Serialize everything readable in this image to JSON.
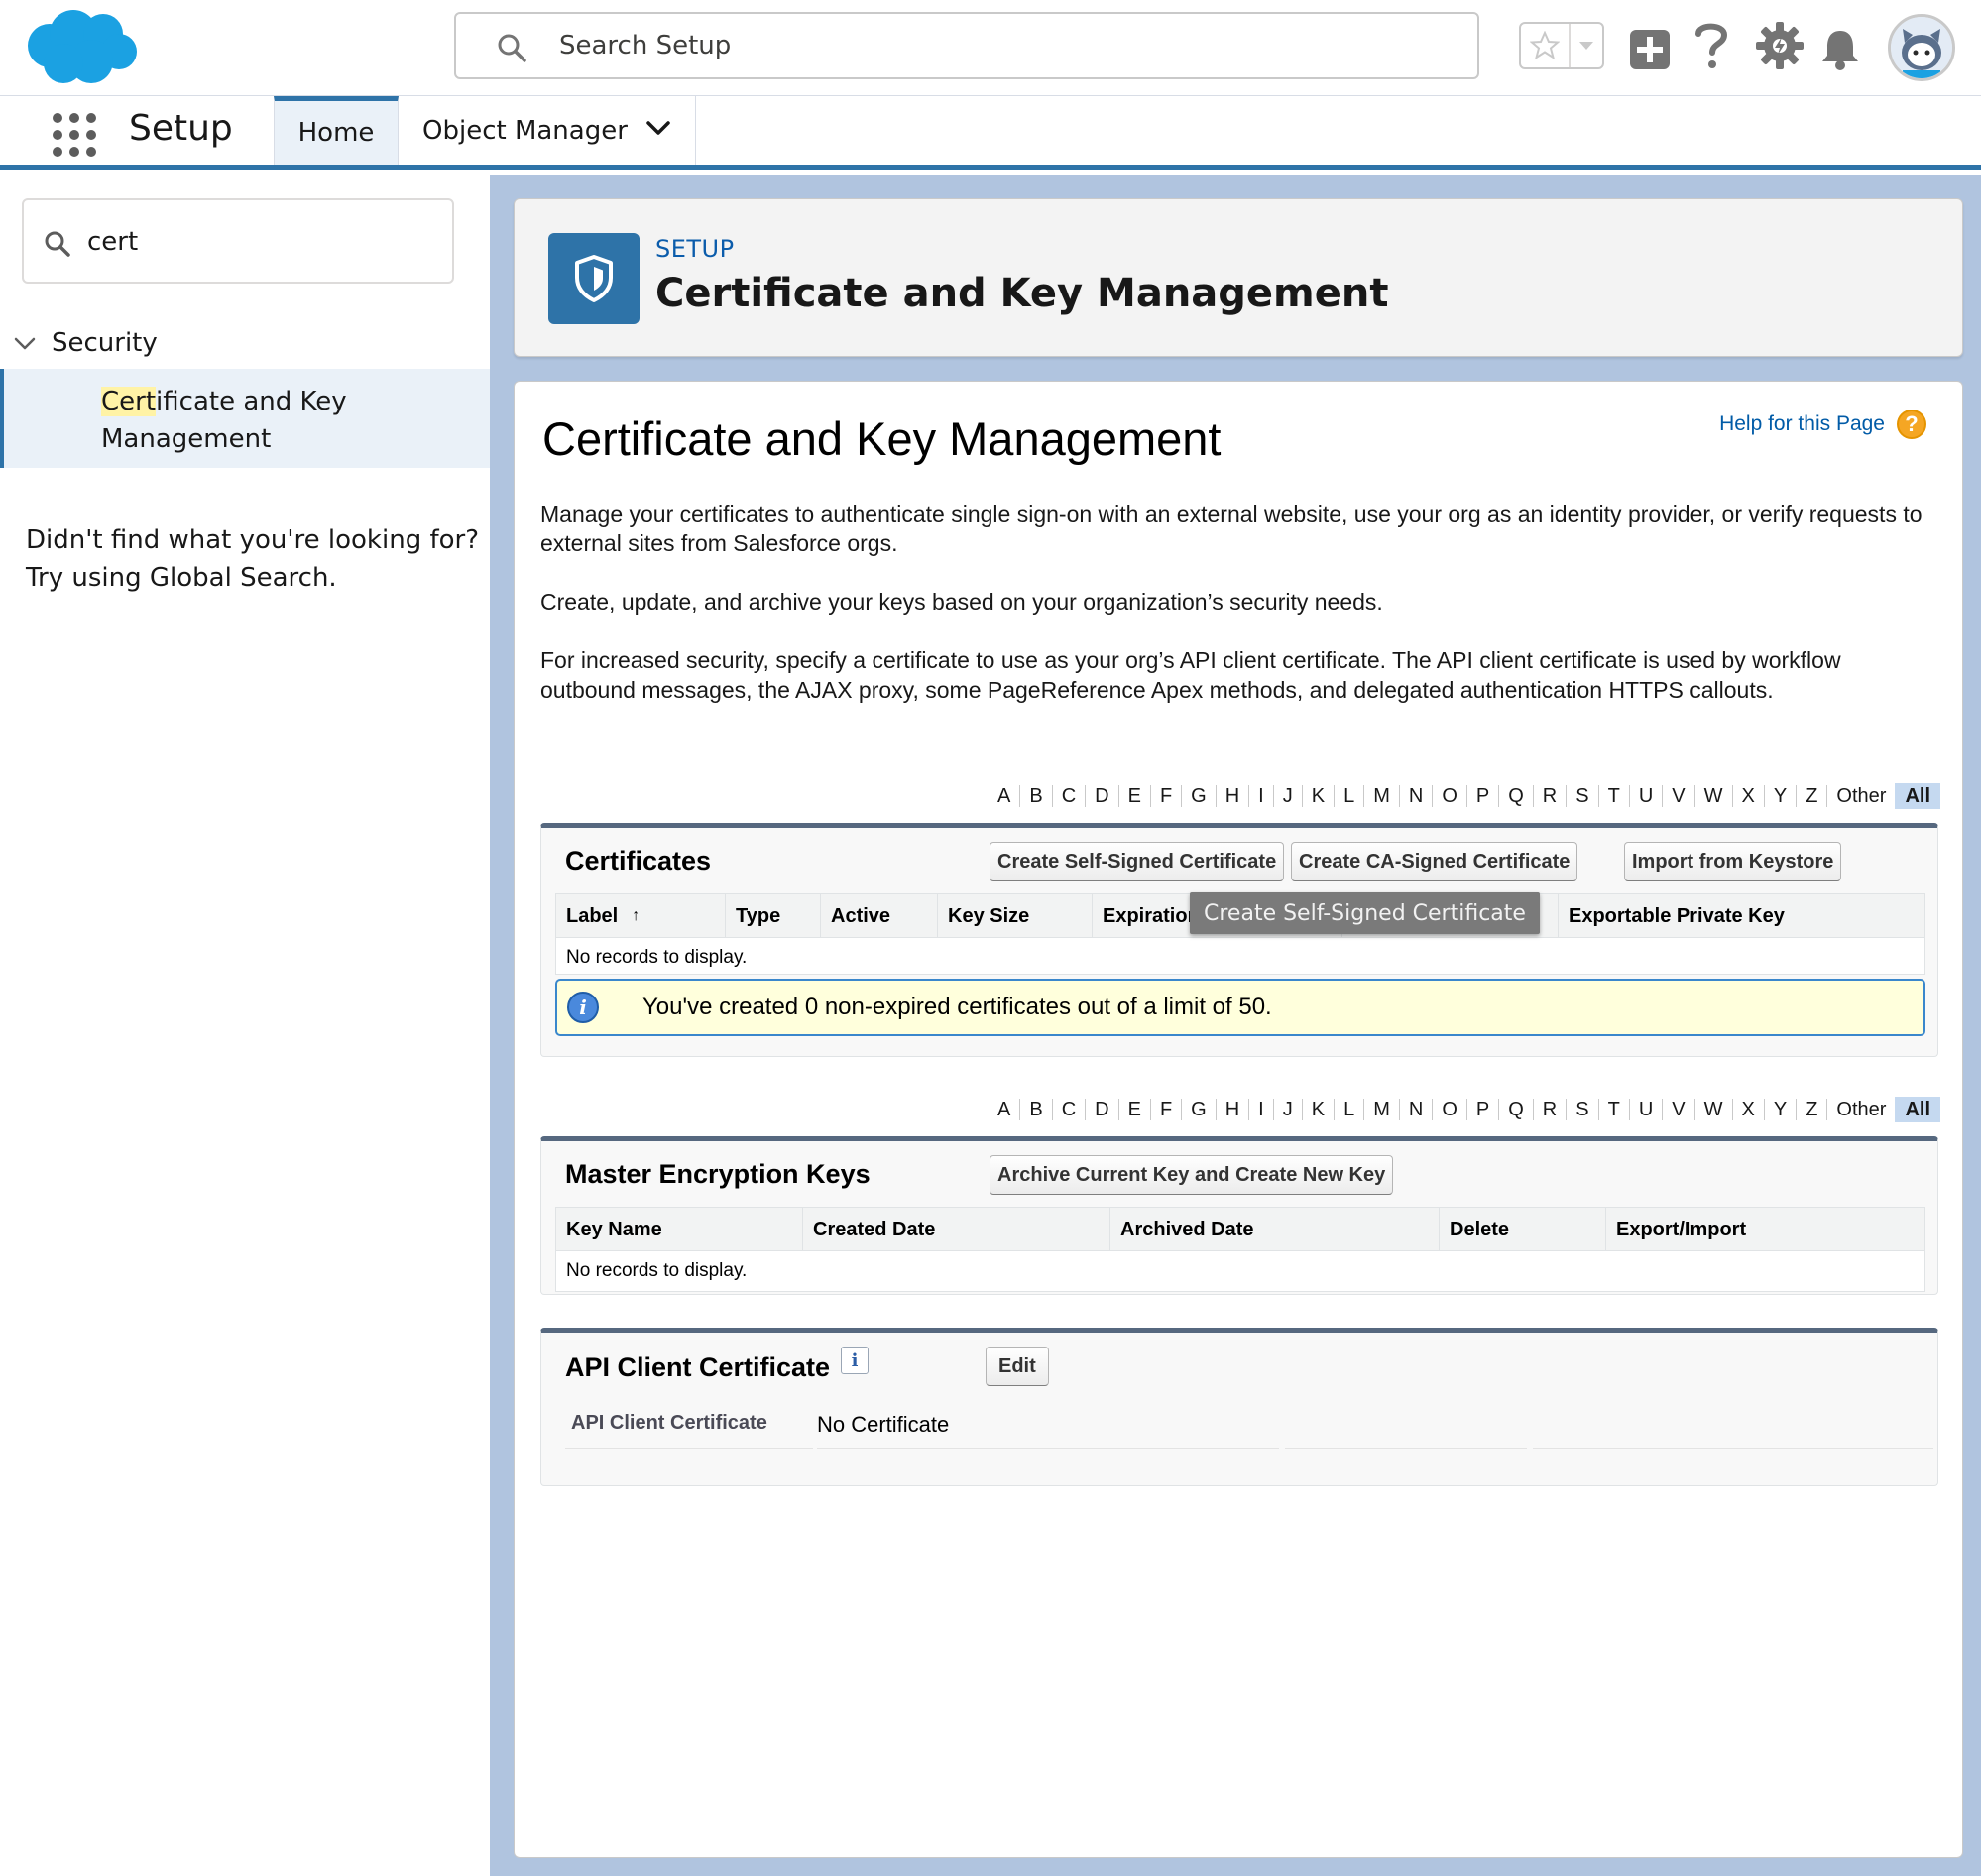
{
  "global_header": {
    "search_placeholder": "Search Setup",
    "brand_color": "#1ba1e2",
    "icons": [
      "salesforce-logo",
      "search-icon",
      "favorites-star-icon",
      "favorites-menu-icon",
      "global-actions-plus-icon",
      "help-question-icon",
      "setup-gear-icon",
      "notifications-bell-icon",
      "user-avatar"
    ]
  },
  "context_bar": {
    "app_name": "Setup",
    "tabs": [
      {
        "label": "Home"
      },
      {
        "label": "Object Manager"
      }
    ]
  },
  "sidebar": {
    "quick_find_value": "cert",
    "tree": {
      "group_label": "Security",
      "item_label_highlight": "Cert",
      "item_label_rest": "ificate and Key",
      "item_label_line2": "Management"
    },
    "not_found_line1": "Didn't find what you're looking for?",
    "not_found_line2": "Try using Global Search."
  },
  "page_header": {
    "eyebrow": "SETUP",
    "title": "Certificate and Key Management"
  },
  "content": {
    "title": "Certificate and Key Management",
    "help_link": "Help for this Page",
    "description": [
      "Manage your certificates to authenticate single sign-on with an external website, use your org as an identity provider, or verify requests to external sites from Salesforce orgs.",
      "Create, update, and archive your keys based on your organization’s security needs.",
      "For increased security, specify a certificate to use as your org’s API client certificate. The API client certificate is used by workflow outbound messages, the AJAX proxy, some PageReference Apex methods, and delegated authentication HTTPS callouts."
    ],
    "alpha_filter": [
      "A",
      "B",
      "C",
      "D",
      "E",
      "F",
      "G",
      "H",
      "I",
      "J",
      "K",
      "L",
      "M",
      "N",
      "O",
      "P",
      "Q",
      "R",
      "S",
      "T",
      "U",
      "V",
      "W",
      "X",
      "Y",
      "Z",
      "Other",
      "All"
    ],
    "alpha_selected": "All",
    "certificates": {
      "title": "Certificates",
      "buttons": [
        "Create Self-Signed Certificate",
        "Create CA-Signed Certificate",
        "Import from Keystore"
      ],
      "columns": [
        "Label",
        "Type",
        "Active",
        "Key Size",
        "Expiration",
        "",
        "Exportable Private Key"
      ],
      "sort_indicator": "↑",
      "empty_message": "No records to display.",
      "info_message": "You've created 0 non-expired certificates out of a limit of 50.",
      "tooltip": "Create Self-Signed Certificate"
    },
    "master_keys": {
      "title": "Master Encryption Keys",
      "button": "Archive Current Key and Create New Key",
      "columns": [
        "Key Name",
        "Created Date",
        "Archived Date",
        "Delete",
        "Export/Import"
      ],
      "empty_message": "No records to display."
    },
    "api_client_cert": {
      "title": "API Client Certificate",
      "info_icon": "i",
      "button": "Edit",
      "field_label": "API Client Certificate",
      "field_value": "No Certificate"
    }
  }
}
